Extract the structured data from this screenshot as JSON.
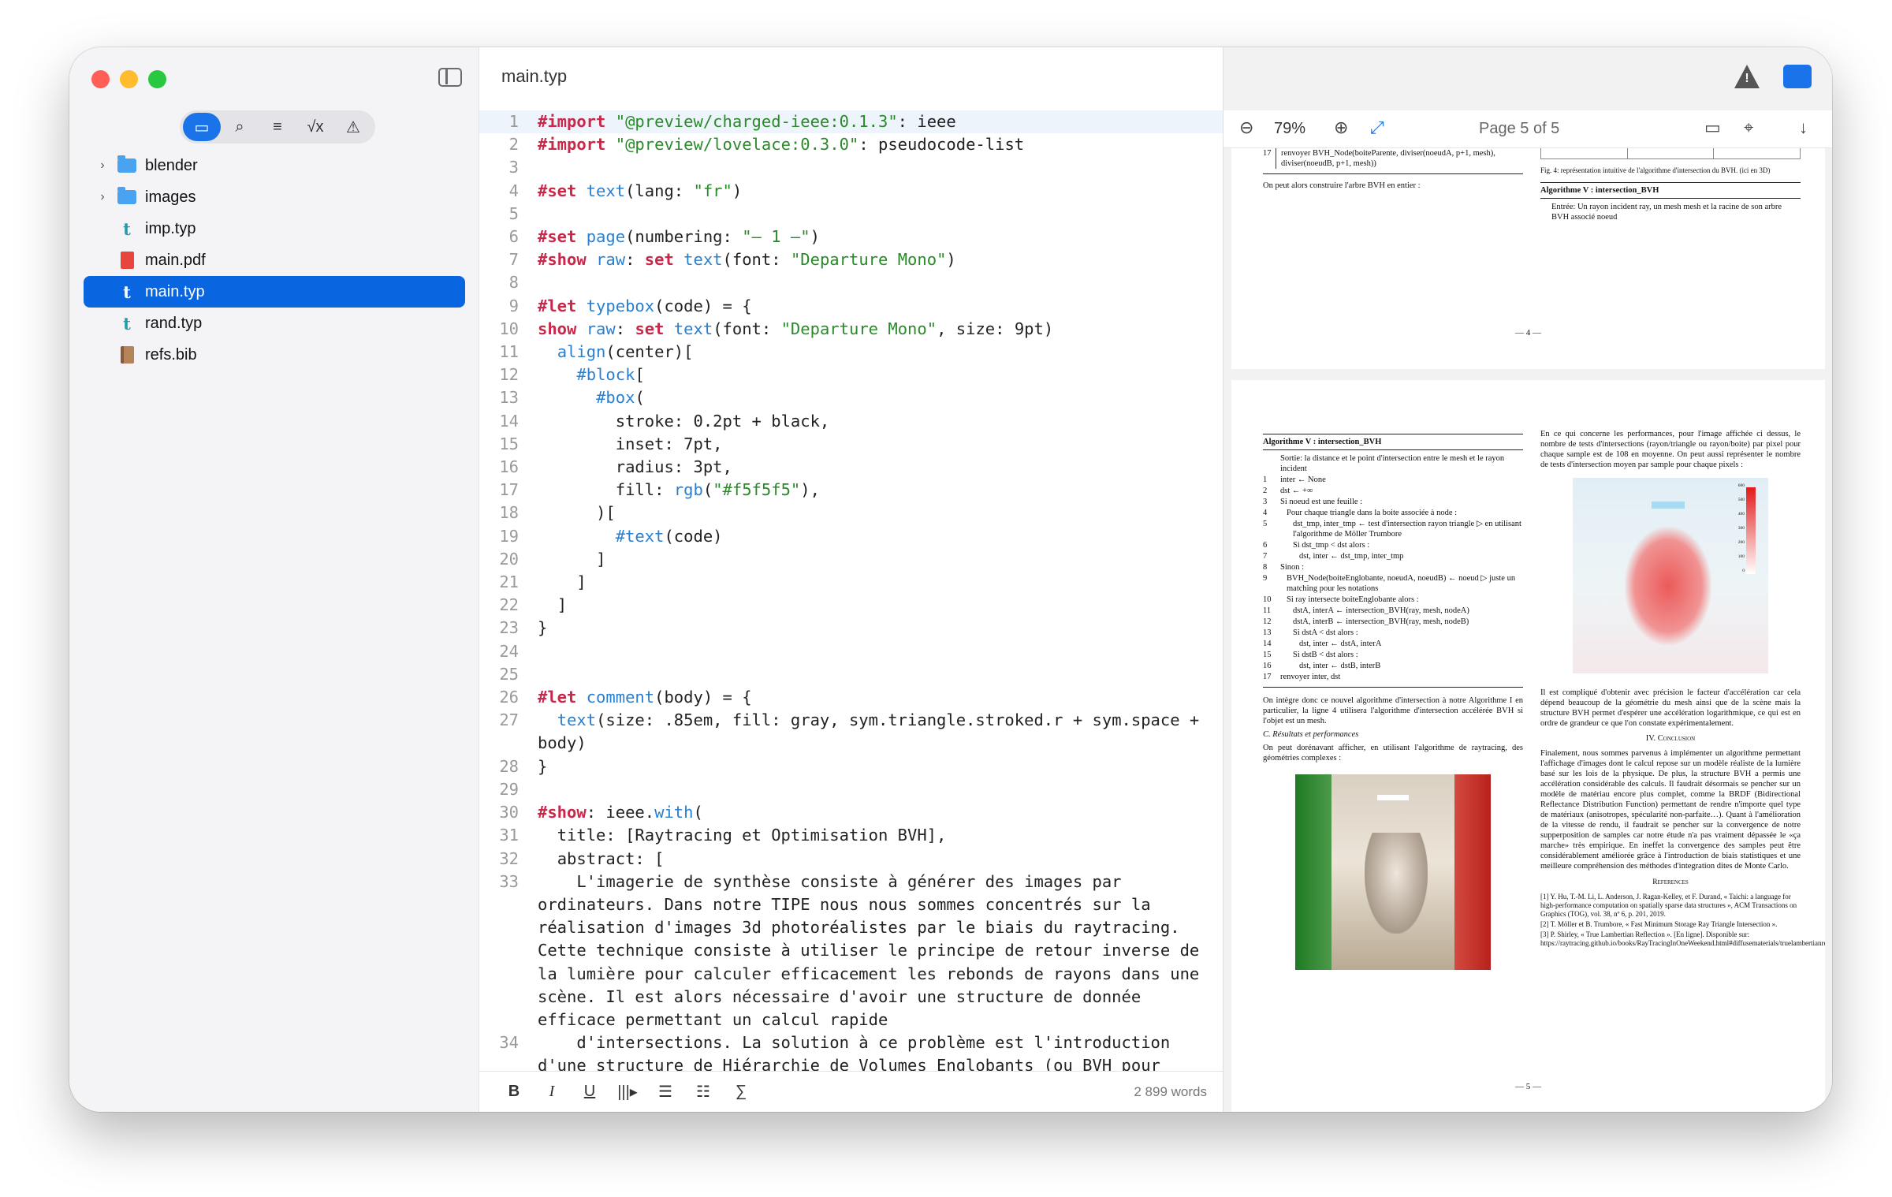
{
  "sidebar": {
    "files": [
      {
        "name": "blender",
        "type": "folder"
      },
      {
        "name": "images",
        "type": "folder"
      },
      {
        "name": "imp.typ",
        "type": "typ"
      },
      {
        "name": "main.pdf",
        "type": "pdf"
      },
      {
        "name": "main.typ",
        "type": "typ",
        "selected": true
      },
      {
        "name": "rand.typ",
        "type": "typ"
      },
      {
        "name": "refs.bib",
        "type": "bib"
      }
    ],
    "tabs": [
      "files-icon",
      "search-icon",
      "outline-icon",
      "math-icon",
      "warning-icon"
    ]
  },
  "editor": {
    "title": "main.typ",
    "word_count": "2 899 words",
    "lines": [
      {
        "n": "1",
        "t": "#import \"@preview/charged-ieee:0.1.3\": ieee"
      },
      {
        "n": "2",
        "t": "#import \"@preview/lovelace:0.3.0\": pseudocode-list"
      },
      {
        "n": "3",
        "t": ""
      },
      {
        "n": "4",
        "t": "#set text(lang: \"fr\")"
      },
      {
        "n": "5",
        "t": ""
      },
      {
        "n": "6",
        "t": "#set page(numbering: \"— 1 —\")"
      },
      {
        "n": "7",
        "t": "#show raw: set text(font: \"Departure Mono\")"
      },
      {
        "n": "8",
        "t": ""
      },
      {
        "n": "9",
        "t": "#let typebox(code) = {"
      },
      {
        "n": "10",
        "t": "show raw: set text(font: \"Departure Mono\", size: 9pt)"
      },
      {
        "n": "11",
        "t": "  align(center)["
      },
      {
        "n": "12",
        "t": "    #block["
      },
      {
        "n": "13",
        "t": "      #box("
      },
      {
        "n": "14",
        "t": "        stroke: 0.2pt + black,"
      },
      {
        "n": "15",
        "t": "        inset: 7pt,"
      },
      {
        "n": "16",
        "t": "        radius: 3pt,"
      },
      {
        "n": "17",
        "t": "        fill: rgb(\"#f5f5f5\"),"
      },
      {
        "n": "18",
        "t": "      )["
      },
      {
        "n": "19",
        "t": "        #text(code)"
      },
      {
        "n": "20",
        "t": "      ]"
      },
      {
        "n": "21",
        "t": "    ]"
      },
      {
        "n": "22",
        "t": "  ]"
      },
      {
        "n": "23",
        "t": "}"
      },
      {
        "n": "24",
        "t": ""
      },
      {
        "n": "25",
        "t": ""
      },
      {
        "n": "26",
        "t": "#let comment(body) = {"
      },
      {
        "n": "27",
        "t": "  text(size: .85em, fill: gray, sym.triangle.stroked.r + sym.space + body)"
      },
      {
        "n": "28",
        "t": "}"
      },
      {
        "n": "29",
        "t": ""
      },
      {
        "n": "30",
        "t": "#show: ieee.with("
      },
      {
        "n": "31",
        "t": "  title: [Raytracing et Optimisation BVH],"
      },
      {
        "n": "32",
        "t": "  abstract: ["
      },
      {
        "n": "33",
        "t": "    L'imagerie de synthèse consiste à générer des images par ordinateurs. Dans notre TIPE nous nous sommes concentrés sur la réalisation d'images 3d photoréalistes par le biais du raytracing. Cette technique consiste à utiliser le principe de retour inverse de la lumière pour calculer efficacement les rebonds de rayons dans une scène. Il est alors nécessaire d'avoir une structure de donnée efficace permettant un calcul rapide"
      },
      {
        "n": "34",
        "t": "    d'intersections. La solution à ce problème est l'introduction d'une structure de Hiérarchie de Volumes Englobants (ou BVH pour"
      }
    ]
  },
  "preview": {
    "zoom": "79%",
    "page_indicator": "Page 5 of 5",
    "page4": {
      "line17": "renvoyer BVH_Node(boiteParente, diviser(noeudA, p+1, mesh), diviser(noeudB, p+1, mesh))",
      "left_text": "On peut alors construire l'arbre BVH en entier :",
      "fig_caption": "Fig. 4: représentation intuitive de l'algorithme d'intersection du BVH. (ici en 3D)",
      "algo_title": "Algorithme V : intersection_BVH",
      "algo_input": "Entrée: Un rayon incident ray, un mesh mesh et la racine de son arbre BVH associé noeud",
      "page_number": "— 4 —"
    },
    "page5": {
      "algo_title": "Algorithme V : intersection_BVH",
      "algo_lines": [
        "Sortie: la distance et le point d'intersection entre le mesh et le rayon incident",
        "inter ← None",
        "dst ← +∞",
        "Si noeud est une feuille :",
        "Pour chaque triangle dans la boite associée à node :",
        "dst_tmp, inter_tmp ← test d'intersection rayon triangle ▷ en utilisant l'algorithme de Möller Trumbore",
        "Si dst_tmp < dst alors :",
        "dst, inter ← dst_tmp, inter_tmp",
        "Sinon :",
        "BVH_Node(boiteEnglobante, noeudA, noeudB) ← noeud ▷ juste un matching pour les notations",
        "Si ray intersecte boiteEnglobante alors :",
        "dstA, interA ← intersection_BVH(ray, mesh, nodeA)",
        "dstA, interB ← intersection_BVH(ray, mesh, nodeB)",
        "Si dstA < dst alors :",
        "dst, inter ← dstA, interA",
        "Si dstB < dst alors :",
        "dst, inter ← dstB, interB",
        "renvoyer inter, dst"
      ],
      "left_after": "On intègre donc ce nouvel algorithme d'intersection à notre Algorithme I en particulier, la ligne 4 utilisera l'algorithme d'intersection accélérée BVH si l'objet est un mesh.",
      "subsection": "C. Résultats et performances",
      "left_after2": "On peut dorénavant afficher, en utilisant l'algorithme de raytracing, des géométries complexes :",
      "right_top": "En ce qui concerne les performances, pour l'image affichée ci dessus, le nombre de tests d'intersections (rayon/triangle ou rayon/boite) par pixel pour chaque sample est de 108 en moyenne. On peut aussi représenter le nombre de tests d'intersection moyen par sample pour chaque pixels :",
      "right_mid": "Il est compliqué d'obtenir avec précision le facteur d'accélération car cela dépend beaucoup de la géométrie du mesh ainsi que de la scène mais la structure BVH permet d'espérer une accélération logarithmique, ce qui est en ordre de grandeur ce que l'on constate expérimentalement.",
      "section": "IV. Conclusion",
      "conclusion": "Finalement, nous sommes parvenus à implémenter un algorithme permettant l'affichage d'images dont le calcul repose sur un modèle réaliste de la lumière basé sur les lois de la physique. De plus, la structure BVH a permis une accélération considérable des calculs. Il faudrait désormais se pencher sur un modèle de matériau encore plus complet, comme la BRDF (Bidirectional Reflectance Distribution Function) permettant de rendre n'importe quel type de matériaux (anisotropes, spécularité non-parfaite…). Quant à l'amélioration de la vitesse de rendu, il faudrait se pencher sur la convergence de notre supperposition de samples car notre étude n'a pas vraiment dépassée le «ça marche» très empirique. En ineffet la convergence des samples peut être considérablement améliorée grâce à l'introduction de biais statistiques et une meilleure compréhension des méthodes d'integration dites de Monte Carlo.",
      "refs_title": "References",
      "refs": [
        "[1] Y. Hu, T.-M. Li, L. Anderson, J. Ragan-Kelley, et F. Durand, « Taichi: a language for high-performance computation on spatially sparse data structures », ACM Transactions on Graphics (TOG), vol. 38, nº 6, p. 201, 2019.",
        "[2] T. Möller et B. Trumbore, « Fast Minimum Storage Ray Triangle Intersection ».",
        "[3] P. Shirley, « True Lambertian Reflection ». [En ligne]. Disponible sur: https://raytracing.github.io/books/RayTracingInOneWeekend.html#diffusematerials/truelambertianreflection"
      ],
      "colorbar_ticks": [
        "600",
        "500",
        "400",
        "300",
        "200",
        "100",
        "0"
      ],
      "page_number": "— 5 —"
    }
  },
  "colors": {
    "accent": "#0a66e0",
    "keyword": "#c8284a",
    "string": "#2a8a2a",
    "function": "#2a7fcf"
  }
}
